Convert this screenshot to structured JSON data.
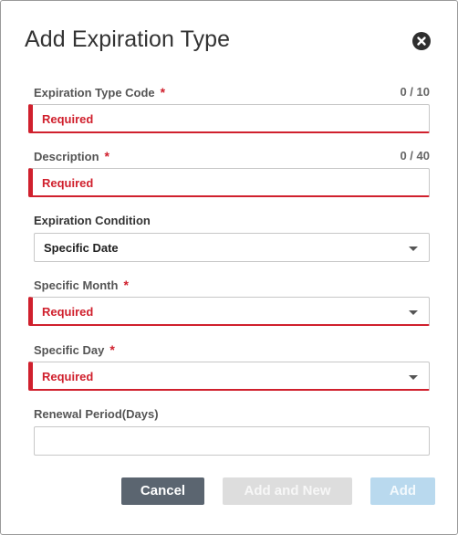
{
  "dialog": {
    "title": "Add Expiration Type",
    "close_icon": "close-circle-icon"
  },
  "fields": {
    "code": {
      "label": "Expiration Type Code",
      "required_mark": "*",
      "counter": "0 / 10",
      "value": "Required"
    },
    "description": {
      "label": "Description",
      "required_mark": "*",
      "counter": "0 / 40",
      "value": "Required"
    },
    "condition": {
      "label": "Expiration Condition",
      "value": "Specific Date"
    },
    "month": {
      "label": "Specific Month",
      "required_mark": "*",
      "value": "Required"
    },
    "day": {
      "label": "Specific Day",
      "required_mark": "*",
      "value": "Required"
    },
    "renewal": {
      "label": "Renewal Period(Days)",
      "value": ""
    }
  },
  "buttons": {
    "cancel": "Cancel",
    "add_and_new": "Add and New",
    "add": "Add"
  },
  "colors": {
    "error": "#d0202d",
    "cancel_bg": "#5b6570",
    "add_and_new_bg": "#dddddd",
    "add_bg": "#b9d9ee"
  }
}
